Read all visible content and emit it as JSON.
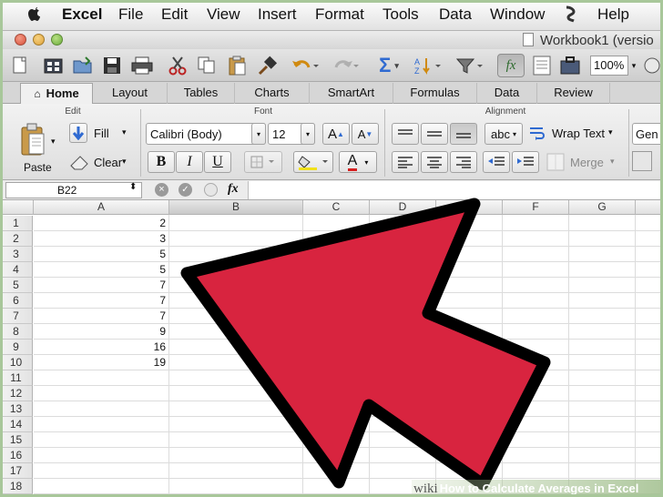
{
  "menubar": {
    "app_name": "Excel",
    "items": [
      "File",
      "Edit",
      "View",
      "Insert",
      "Format",
      "Tools",
      "Data",
      "Window",
      "Help"
    ]
  },
  "window": {
    "title": "Workbook1 (versio"
  },
  "toolbar": {
    "zoom": "100%",
    "icons": [
      "new-icon",
      "templates-icon",
      "open-icon",
      "save-icon",
      "print-icon",
      "cut-icon",
      "copy-icon",
      "paste-icon",
      "format-painter-icon",
      "undo-icon",
      "redo-icon",
      "autosum-icon",
      "sort-icon",
      "filter-icon",
      "formula-builder-icon",
      "gallery-icon",
      "toolbox-icon",
      "zoom-icon",
      "help-icon"
    ]
  },
  "ribbon": {
    "tabs": [
      "Home",
      "Layout",
      "Tables",
      "Charts",
      "SmartArt",
      "Formulas",
      "Data",
      "Review"
    ],
    "active_tab": "Home",
    "groups": {
      "edit": "Edit",
      "font": "Font",
      "alignment": "Alignment"
    },
    "paste_label": "Paste",
    "fill_label": "Fill",
    "clear_label": "Clear",
    "font_name": "Calibri (Body)",
    "font_size": "12",
    "bold": "B",
    "italic": "I",
    "underline": "U",
    "wrap_text_label": "Wrap Text",
    "merge_label": "Merge",
    "number_format": "abc",
    "general_label": "Gen",
    "font_grow": "A",
    "font_shrink": "A",
    "text_color": "A"
  },
  "formula_bar": {
    "cell_reference": "B22",
    "fx_label": "fx",
    "content": ""
  },
  "sheet": {
    "columns": [
      "A",
      "B",
      "C",
      "D",
      "E",
      "F",
      "G"
    ],
    "selected_column": "B",
    "rows": [
      "1",
      "2",
      "3",
      "4",
      "5",
      "6",
      "7",
      "8",
      "9",
      "10",
      "11",
      "12",
      "13",
      "14",
      "15",
      "16",
      "17",
      "18"
    ],
    "column_a_values": [
      "2",
      "3",
      "5",
      "5",
      "7",
      "7",
      "7",
      "9",
      "16",
      "19"
    ]
  },
  "overlay": {
    "arrow_color": "#d8243f",
    "arrow_outline": "#000000"
  },
  "watermark": {
    "brand": "wiki",
    "text": "How to Calculate Averages in Excel"
  },
  "colors": {
    "accent_green": "#a8c79a",
    "ribbon_bg": "#e8e8e8"
  }
}
